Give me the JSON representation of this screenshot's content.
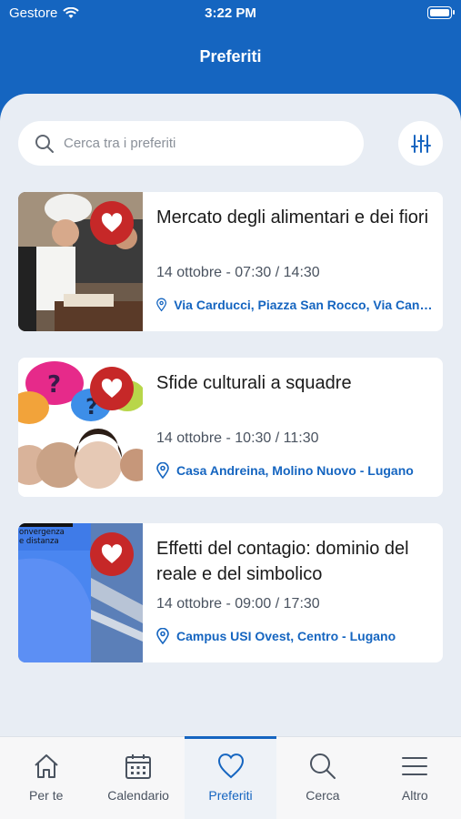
{
  "status": {
    "carrier": "Gestore",
    "time": "3:22 PM"
  },
  "header": {
    "title": "Preferiti"
  },
  "search": {
    "placeholder": "Cerca tra i preferiti"
  },
  "events": [
    {
      "title": "Mercato degli alimentari e dei fiori",
      "date": "14 ottobre - 07:30 / 14:30",
      "place": "Via Carducci, Piazza San Rocco, Via Canova - Lugano"
    },
    {
      "title": "Sfide culturali a squadre",
      "date": "14 ottobre - 10:30 / 11:30",
      "place": "Casa Andreina, Molino Nuovo - Lugano"
    },
    {
      "title": "Effetti del contagio: dominio del reale e del simbolico",
      "date": "14 ottobre - 09:00 / 17:30",
      "place": "Campus USI Ovest, Centro - Lugano",
      "thumb_text": "onvergenza\ne distanza"
    }
  ],
  "tabs": [
    {
      "label": "Per te",
      "icon": "home-icon"
    },
    {
      "label": "Calendario",
      "icon": "calendar-icon"
    },
    {
      "label": "Preferiti",
      "icon": "heart-icon",
      "active": true
    },
    {
      "label": "Cerca",
      "icon": "search-icon"
    },
    {
      "label": "Altro",
      "icon": "menu-icon"
    }
  ],
  "colors": {
    "primary": "#1565c0",
    "favorite": "#c62828",
    "background": "#e8edf4"
  }
}
